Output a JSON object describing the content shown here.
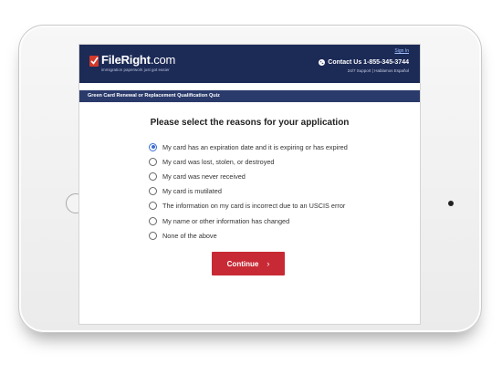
{
  "header": {
    "logo_text": "FileRight",
    "logo_suffix": ".com",
    "tagline": "immigration paperwork just got easier",
    "signin_label": "Sign In",
    "contact_label": "Contact Us 1-855-345-3744",
    "support_label": "24/7 Support | Hablamos Español"
  },
  "quiz": {
    "title": "Green Card Renewal or Replacement Qualification Quiz",
    "question": "Please select the reasons for your application",
    "options": [
      {
        "label": "My card has an expiration date and it is expiring or has expired",
        "selected": true
      },
      {
        "label": "My card was lost, stolen, or destroyed",
        "selected": false
      },
      {
        "label": "My card was never received",
        "selected": false
      },
      {
        "label": "My card is mutilated",
        "selected": false
      },
      {
        "label": "The information on my card is incorrect due to an USCIS error",
        "selected": false
      },
      {
        "label": "My name or other information has changed",
        "selected": false
      },
      {
        "label": "None of the above",
        "selected": false
      }
    ],
    "continue_label": "Continue",
    "continue_icon": "chevron-right-icon"
  },
  "colors": {
    "header_bg": "#1c2a56",
    "quiz_bar_bg": "#2a3a6b",
    "accent_red": "#c82a35",
    "radio_selected": "#3c6fd3"
  }
}
